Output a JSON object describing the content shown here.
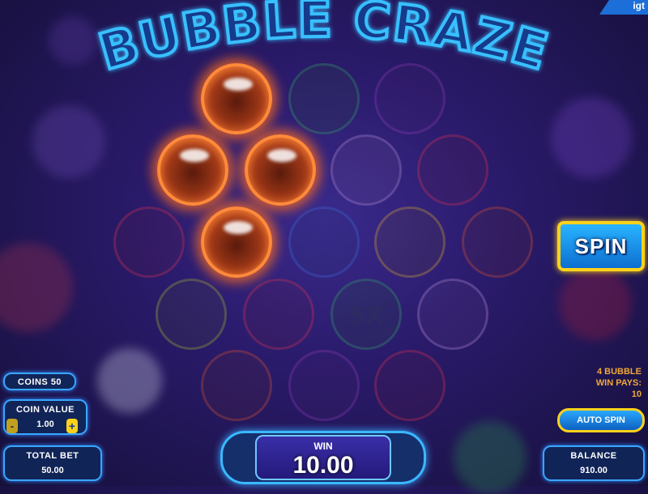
{
  "game": {
    "title": "BUBBLE CRAZE",
    "brand": "igt"
  },
  "grid": {
    "multiplier_label": "5X"
  },
  "controls": {
    "coins_label": "COINS 50",
    "coin_value_label": "COIN VALUE",
    "coin_value": "1.00",
    "minus_symbol": "-",
    "plus_symbol": "+",
    "total_bet_label": "TOTAL BET",
    "total_bet": "50.00",
    "win_label": "WIN",
    "win_amount": "10.00",
    "balance_label": "BALANCE",
    "balance": "910.00",
    "spin_label": "SPIN",
    "auto_spin_label": "AUTO SPIN",
    "pays_line1": "4  BUBBLE",
    "pays_line2": "WIN PAYS:",
    "pays_line3": "10"
  },
  "colors": {
    "accent": "#3aa6ff",
    "highlight": "#ff8a3a",
    "button_border": "#ffd21a",
    "pays_text": "#f0a838"
  }
}
